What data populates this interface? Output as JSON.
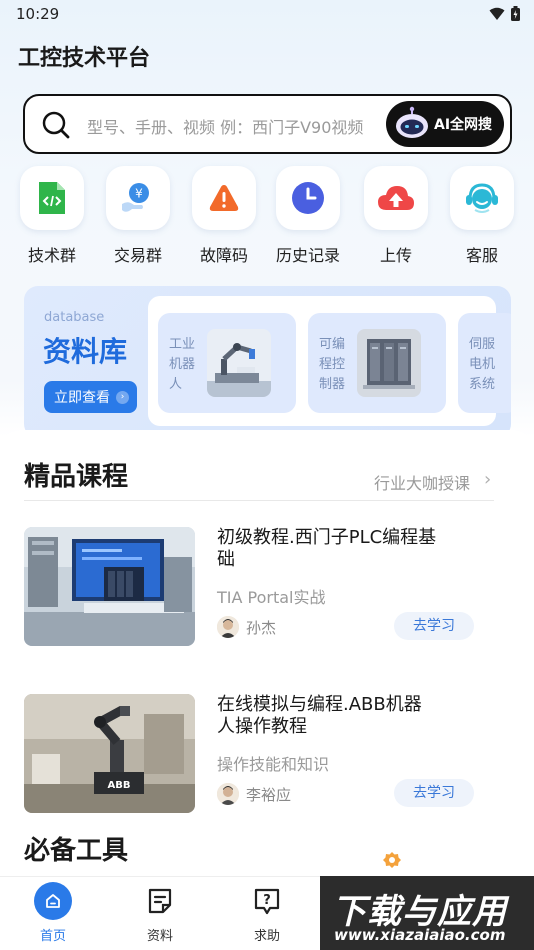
{
  "status_bar": {
    "time": "10:29"
  },
  "app_title": "工控技术平台",
  "search": {
    "placeholder": "型号、手册、视频 例：西门子V90视频",
    "ai_button": "AI全网搜"
  },
  "quick_actions": [
    {
      "label": "技术群",
      "icon": "code-file-icon",
      "color": "#2fb54a"
    },
    {
      "label": "交易群",
      "icon": "yen-hand-icon",
      "color": "#3a8de6"
    },
    {
      "label": "故障码",
      "icon": "warning-icon",
      "color": "#f06a2a"
    },
    {
      "label": "历史记录",
      "icon": "clock-icon",
      "color": "#4a5fe0"
    },
    {
      "label": "上传",
      "icon": "cloud-upload-icon",
      "color": "#ef4747"
    },
    {
      "label": "客服",
      "icon": "headset-icon",
      "color": "#2bb8d6"
    }
  ],
  "database": {
    "subtitle": "database",
    "title": "资料库",
    "button": "立即查看",
    "cards": [
      {
        "label": "工业机器人",
        "lines": [
          "工业",
          "机器",
          "人"
        ]
      },
      {
        "label": "可编程控制器",
        "lines": [
          "可编",
          "程控",
          "制器"
        ]
      },
      {
        "label": "伺服电机系统",
        "lines": [
          "伺服",
          "电机",
          "系统"
        ]
      }
    ]
  },
  "courses_section": {
    "title": "精品课程",
    "more": "行业大咖授课",
    "items": [
      {
        "title_line1": "初级教程.西门子PLC编程基",
        "title_line2": "础",
        "subtitle": "TIA Portal实战",
        "teacher": "孙杰",
        "button": "去学习"
      },
      {
        "title_line1": "在线模拟与编程.ABB机器",
        "title_line2": "人操作教程",
        "subtitle": "操作技能和知识",
        "teacher": "李裕应",
        "button": "去学习"
      }
    ]
  },
  "tools_section": {
    "title": "必备工具"
  },
  "bottom_nav": [
    {
      "label": "首页",
      "icon": "home-icon",
      "active": true
    },
    {
      "label": "资料",
      "icon": "document-icon",
      "active": false
    },
    {
      "label": "求助",
      "icon": "help-chat-icon",
      "active": false
    }
  ],
  "watermark": {
    "main": "下载与应用",
    "url": "www.xiazaiaiao.com"
  },
  "colors": {
    "accent": "#2a7ae8",
    "database_title": "#1f6bdc"
  }
}
